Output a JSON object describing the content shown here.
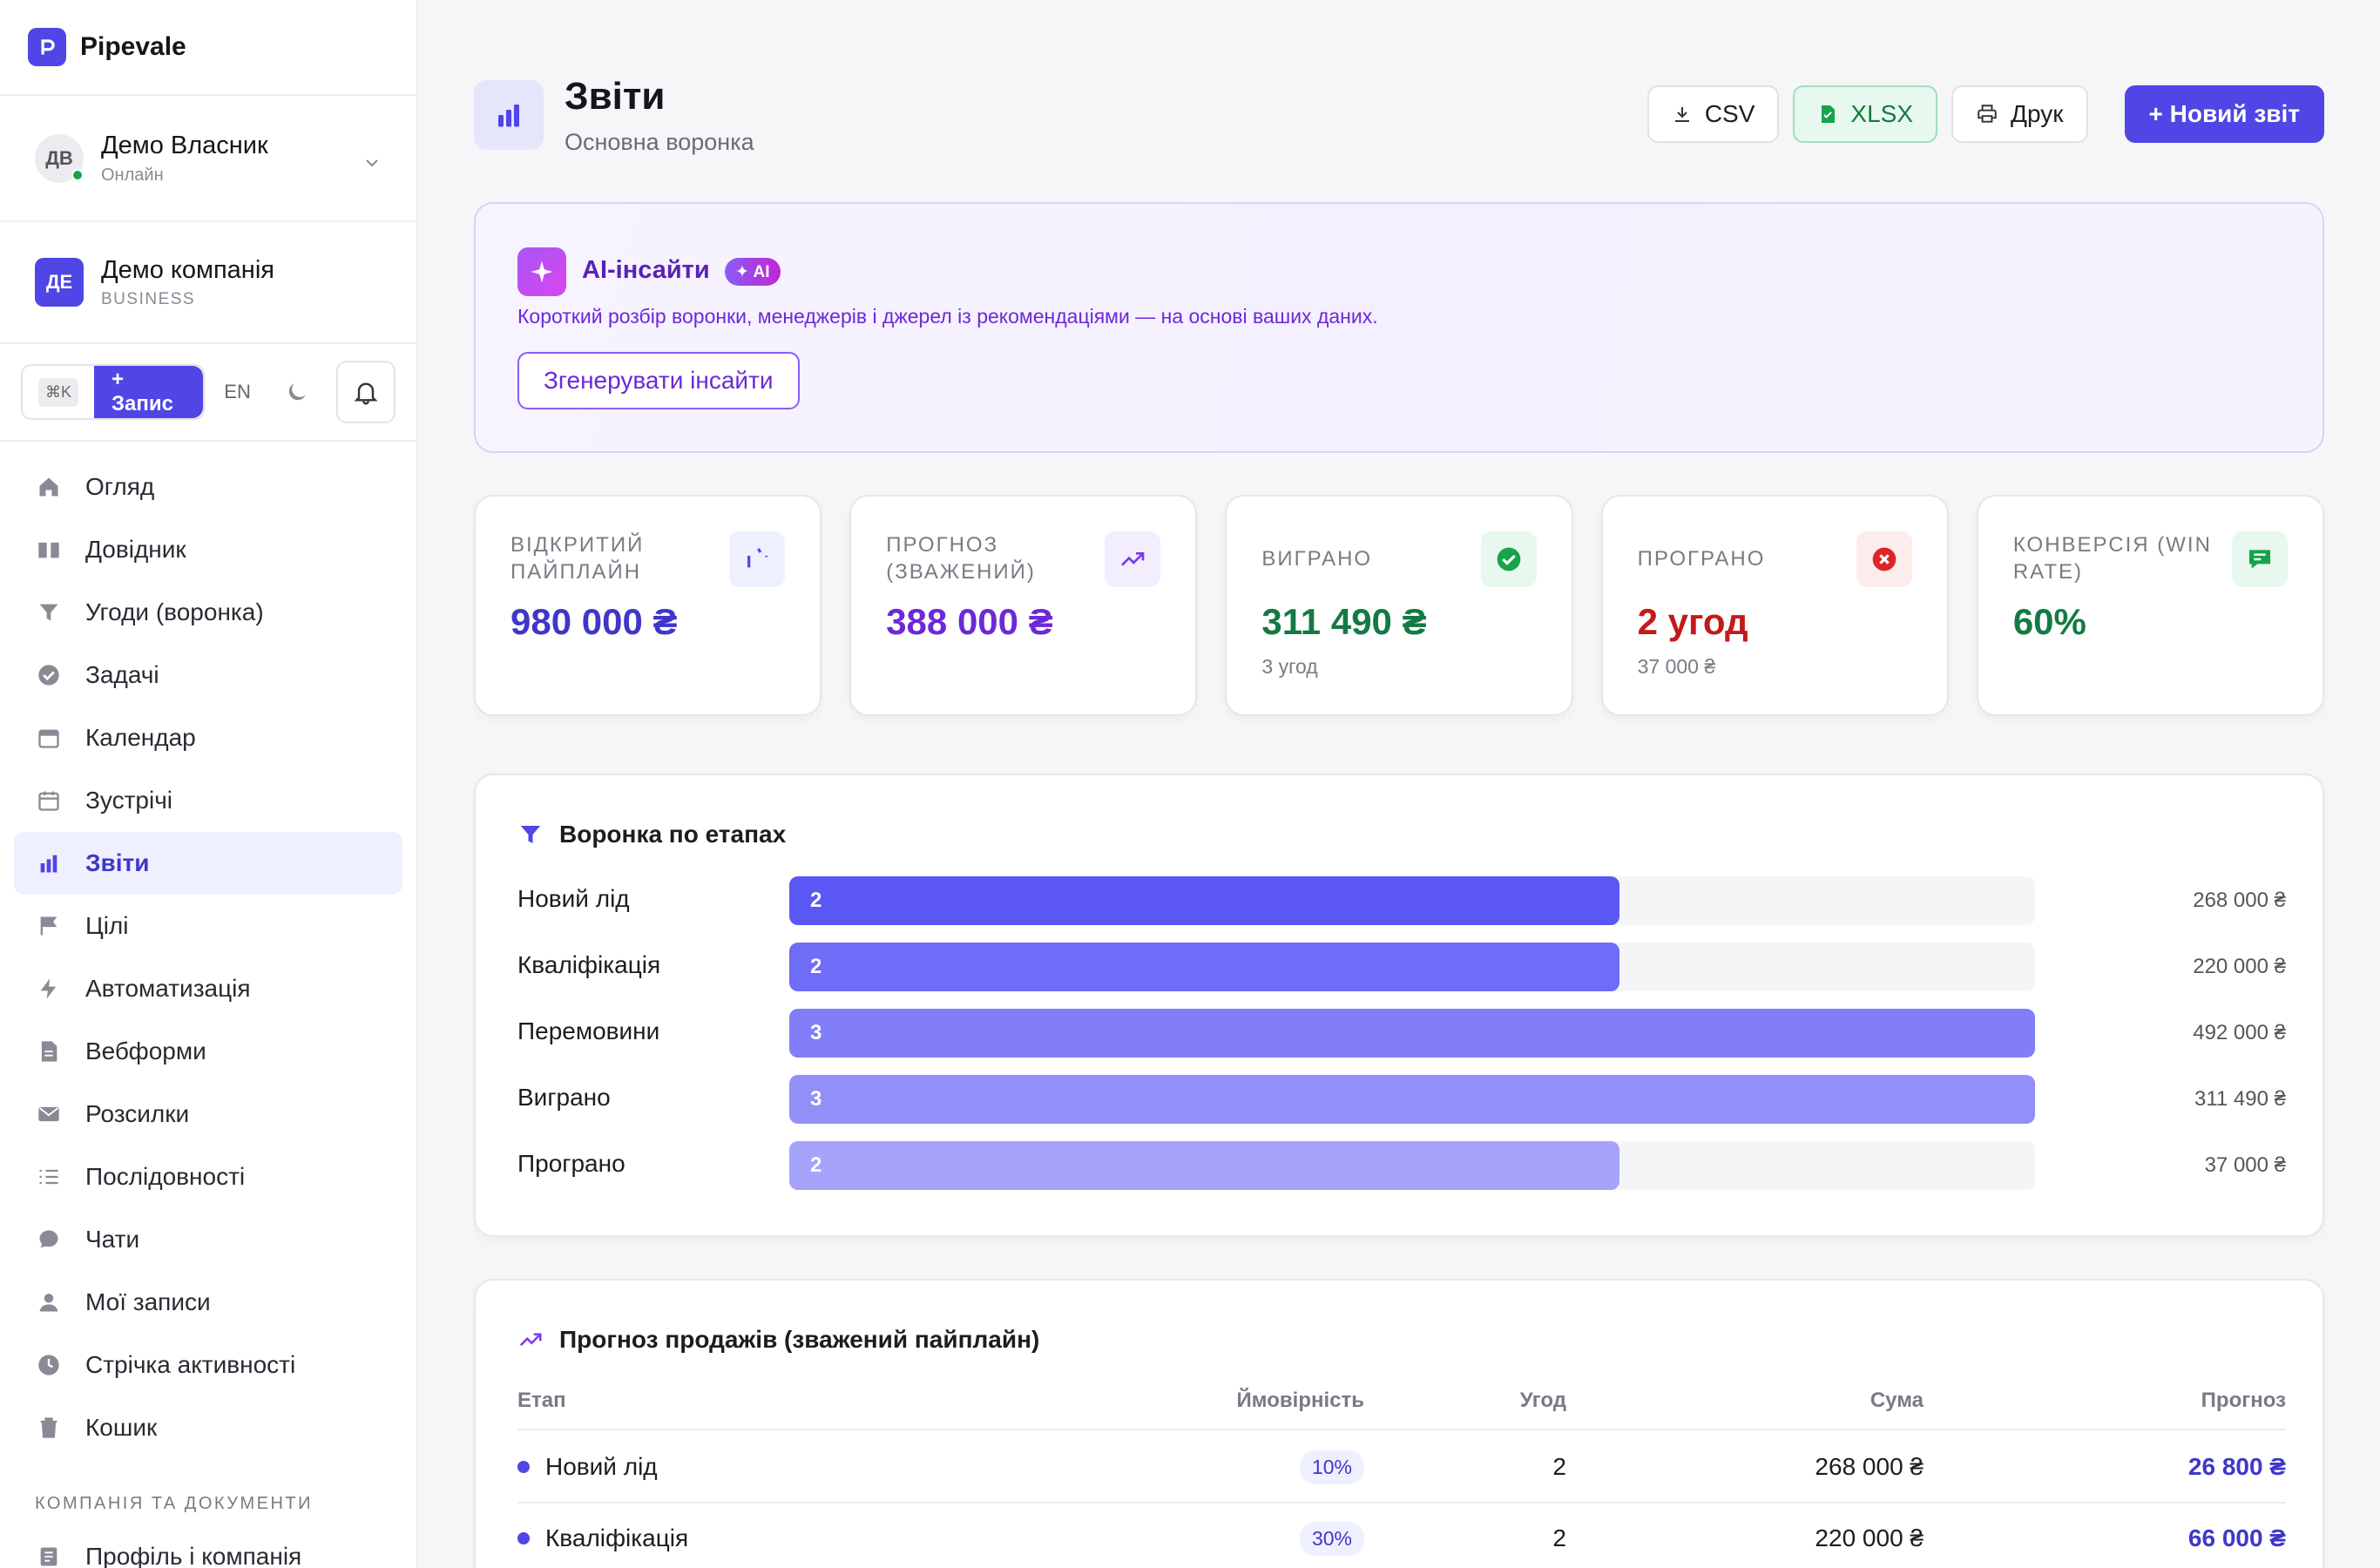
{
  "brand": {
    "name": "Pipevale"
  },
  "user": {
    "initials": "ДВ",
    "name": "Демо Власник",
    "status": "Онлайн"
  },
  "company": {
    "initials": "ДЕ",
    "name": "Демо компанія",
    "plan": "BUSINESS"
  },
  "toolbar": {
    "shortcut": "⌘K",
    "record_label": "+ Запис",
    "lang": "EN"
  },
  "nav": {
    "items": [
      {
        "label": "Огляд",
        "icon": "home-icon"
      },
      {
        "label": "Довідник",
        "icon": "book-icon"
      },
      {
        "label": "Угоди (воронка)",
        "icon": "funnel-icon"
      },
      {
        "label": "Задачі",
        "icon": "check-circle-icon"
      },
      {
        "label": "Календар",
        "icon": "calendar-icon"
      },
      {
        "label": "Зустрічі",
        "icon": "calendar-outline-icon"
      },
      {
        "label": "Звіти",
        "icon": "bar-chart-icon",
        "active": true
      },
      {
        "label": "Цілі",
        "icon": "flag-icon"
      },
      {
        "label": "Автоматизація",
        "icon": "bolt-icon"
      },
      {
        "label": "Вебформи",
        "icon": "document-icon"
      },
      {
        "label": "Розсилки",
        "icon": "mail-icon"
      },
      {
        "label": "Послідовності",
        "icon": "list-icon"
      },
      {
        "label": "Чати",
        "icon": "chat-icon"
      },
      {
        "label": "Мої записи",
        "icon": "user-icon"
      },
      {
        "label": "Стрічка активності",
        "icon": "clock-icon"
      },
      {
        "label": "Кошик",
        "icon": "trash-icon"
      }
    ],
    "section_label": "КОМПАНІЯ ТА ДОКУМЕНТИ",
    "section_items": [
      {
        "label": "Профіль і компанія",
        "icon": "profile-icon"
      }
    ]
  },
  "header": {
    "title": "Звіти",
    "subtitle": "Основна воронка",
    "csv_label": "CSV",
    "xlsx_label": "XLSX",
    "print_label": "Друк",
    "new_report_label": "+  Новий звіт"
  },
  "ai": {
    "title": "AI-інсайти",
    "badge": "✦ AI",
    "description": "Короткий розбір воронки, менеджерів і джерел із рекомендаціями — на основі ваших даних.",
    "button_label": "Згенерувати інсайти"
  },
  "kpis": [
    {
      "label": "ВІДКРИТИЙ ПАЙПЛАЙН",
      "value": "980 000 ₴",
      "sub": "",
      "color": "#3f37c9",
      "icon": "pie-progress-icon",
      "icon_bg": "#eef0ff"
    },
    {
      "label": "ПРОГНОЗ (ЗВАЖЕНИЙ)",
      "value": "388 000 ₴",
      "sub": "",
      "color": "#6d28d9",
      "icon": "trend-up-icon",
      "icon_bg": "#f3eefe"
    },
    {
      "label": "ВИГРАНО",
      "value": "311 490 ₴",
      "sub": "3 угод",
      "color": "#137a43",
      "icon": "check-circle-icon",
      "icon_bg": "#e7f8ef"
    },
    {
      "label": "ПРОГРАНО",
      "value": "2 угод",
      "sub": "37 000 ₴",
      "color": "#c21a1a",
      "icon": "x-circle-icon",
      "icon_bg": "#fdecec"
    },
    {
      "label": "КОНВЕРСІЯ (WIN RATE)",
      "value": "60%",
      "sub": "",
      "color": "#137a43",
      "icon": "message-icon",
      "icon_bg": "#e7f8ef"
    }
  ],
  "funnel": {
    "title": "Воронка по етапах",
    "max_count": 3,
    "rows": [
      {
        "label": "Новий лід",
        "count": 2,
        "amount": "268 000 ₴",
        "color": "#5b57f5"
      },
      {
        "label": "Кваліфікація",
        "count": 2,
        "amount": "220 000 ₴",
        "color": "#6f6cf7"
      },
      {
        "label": "Перемовини",
        "count": 3,
        "amount": "492 000 ₴",
        "color": "#817ef8"
      },
      {
        "label": "Виграно",
        "count": 3,
        "amount": "311 490 ₴",
        "color": "#938ff9"
      },
      {
        "label": "Програно",
        "count": 2,
        "amount": "37 000 ₴",
        "color": "#a6a3fa"
      }
    ]
  },
  "forecast": {
    "title": "Прогноз продажів (зважений пайплайн)",
    "columns": {
      "stage": "Етап",
      "probability": "Ймовірність",
      "deals": "Угод",
      "sum": "Сума",
      "forecast": "Прогноз"
    },
    "rows": [
      {
        "stage": "Новий лід",
        "probability": "10%",
        "deals": "2",
        "sum": "268 000 ₴",
        "forecast": "26 800 ₴"
      },
      {
        "stage": "Кваліфікація",
        "probability": "30%",
        "deals": "2",
        "sum": "220 000 ₴",
        "forecast": "66 000 ₴"
      }
    ]
  }
}
